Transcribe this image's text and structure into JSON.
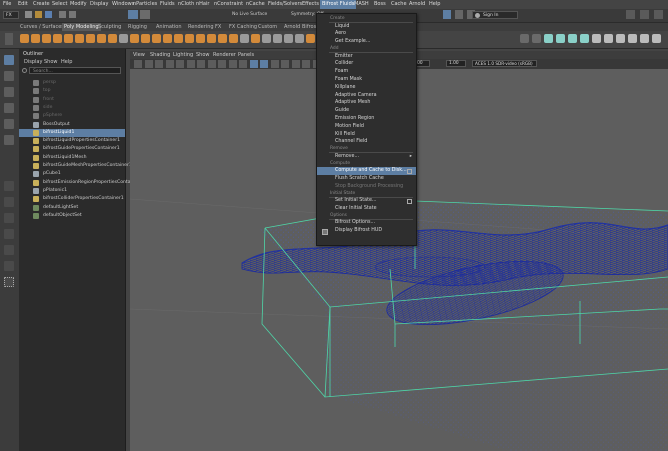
{
  "menubar": {
    "items": [
      "File",
      "Edit",
      "Create",
      "Select",
      "Modify",
      "Display",
      "Windows",
      "nParticles",
      "Fluids",
      "nCloth",
      "nHair",
      "nConstraint",
      "nCache",
      "Fields/Solvers",
      "Effects",
      "Bifrost Fluids",
      "MASH",
      "Boss",
      "Cache",
      "Arnold",
      "Help"
    ],
    "active": "Bifrost Fluids"
  },
  "statusline": {
    "mode": "FX",
    "live_surface": "No Live Surface",
    "symmetry": "Symmetry: Off",
    "sign_in": "Sign In"
  },
  "shelf": {
    "tabs": [
      "Curves / Surfaces",
      "Poly Modeling",
      "Sculpting",
      "Rigging",
      "Animation",
      "Rendering",
      "FX",
      "FX Caching",
      "Custom",
      "Arnold",
      "Bifrost"
    ],
    "active_tab": "Poly Modeling"
  },
  "outliner": {
    "title": "Outliner",
    "menus": [
      "Display",
      "Show",
      "Help"
    ],
    "search_placeholder": "Search...",
    "rows": [
      {
        "label": "persp",
        "state": "dim",
        "indent": 0,
        "color": "#7a7a7a"
      },
      {
        "label": "top",
        "state": "dim",
        "indent": 0,
        "color": "#7a7a7a"
      },
      {
        "label": "front",
        "state": "dim",
        "indent": 0,
        "color": "#7a7a7a"
      },
      {
        "label": "side",
        "state": "dim",
        "indent": 0,
        "color": "#7a7a7a"
      },
      {
        "label": "pSphere",
        "state": "dim",
        "indent": 0,
        "color": "#7a7a7a"
      },
      {
        "label": "BossOutput",
        "state": "normal",
        "indent": 0,
        "color": "#9aa4ad"
      },
      {
        "label": "bifrostLiquid1",
        "state": "selected",
        "indent": 0,
        "color": "#c8b05a"
      },
      {
        "label": "bifrostLiquidPropertiesContainer1",
        "state": "normal",
        "indent": 0,
        "color": "#c8b05a"
      },
      {
        "label": "bifrostGuidePropertiesContainer1",
        "state": "normal",
        "indent": 0,
        "color": "#c8b05a"
      },
      {
        "label": "bifrostLiquid1Mesh",
        "state": "normal",
        "indent": 0,
        "color": "#c8b05a"
      },
      {
        "label": "bifrostGuideMeshPropertiesContainer1",
        "state": "normal",
        "indent": 0,
        "color": "#c8b05a"
      },
      {
        "label": "pCube1",
        "state": "normal",
        "indent": 0,
        "color": "#9aa4ad"
      },
      {
        "label": "bifrostEmissionRegionPropertiesContainer1",
        "state": "normal",
        "indent": 0,
        "color": "#c8b05a"
      },
      {
        "label": "pPlatonic1",
        "state": "normal",
        "indent": 0,
        "color": "#9aa4ad"
      },
      {
        "label": "bifrostColliderPropertiesContainer1",
        "state": "normal",
        "indent": 0,
        "color": "#c8b05a"
      },
      {
        "label": "defaultLightSet",
        "state": "normal",
        "indent": 0,
        "color": "#6f8a5f"
      },
      {
        "label": "defaultObjectSet",
        "state": "normal",
        "indent": 0,
        "color": "#6f8a5f"
      }
    ]
  },
  "viewport": {
    "menus": [
      "View",
      "Shading",
      "Lighting",
      "Show",
      "Renderer",
      "Panels"
    ],
    "field_value_1": "0.00",
    "field_value_2": "1.00",
    "color_space": "ACES 1.0 SDR-video (sRGB)"
  },
  "dropdown": {
    "items": [
      {
        "type": "section",
        "label": "Create"
      },
      {
        "type": "item",
        "label": "Liquid"
      },
      {
        "type": "item",
        "label": "Aero"
      },
      {
        "type": "item",
        "label": "Get Example..."
      },
      {
        "type": "section",
        "label": "Add"
      },
      {
        "type": "item",
        "label": "Emitter"
      },
      {
        "type": "item",
        "label": "Collider"
      },
      {
        "type": "item",
        "label": "Foam"
      },
      {
        "type": "item",
        "label": "Foam Mask"
      },
      {
        "type": "item",
        "label": "Killplane"
      },
      {
        "type": "item",
        "label": "Adaptive Camera"
      },
      {
        "type": "item",
        "label": "Adaptive Mesh"
      },
      {
        "type": "item",
        "label": "Guide"
      },
      {
        "type": "item",
        "label": "Emission Region"
      },
      {
        "type": "item",
        "label": "Motion Field"
      },
      {
        "type": "item",
        "label": "Kill Field"
      },
      {
        "type": "item",
        "label": "Channel Field"
      },
      {
        "type": "section",
        "label": "Remove"
      },
      {
        "type": "item",
        "label": "Remove...",
        "arrow": true
      },
      {
        "type": "section",
        "label": "Compute"
      },
      {
        "type": "item",
        "label": "Compute and Cache to Disk...",
        "highlight": true,
        "box": true
      },
      {
        "type": "item",
        "label": "Flush Scratch Cache"
      },
      {
        "type": "item",
        "label": "Stop Background Processing",
        "disabled": true
      },
      {
        "type": "section",
        "label": "Initial State"
      },
      {
        "type": "item",
        "label": "Set Initial State...",
        "box": true
      },
      {
        "type": "item",
        "label": "Clear Initial State"
      },
      {
        "type": "section",
        "label": "Options"
      },
      {
        "type": "item",
        "label": "Bifrost Options..."
      },
      {
        "type": "item",
        "label": "Display Bifrost HUD",
        "check": true
      }
    ]
  },
  "colors": {
    "selection": "#5d7ea3",
    "fluid": "#1a2aa0",
    "bounding_box": "#4fd6a8"
  }
}
